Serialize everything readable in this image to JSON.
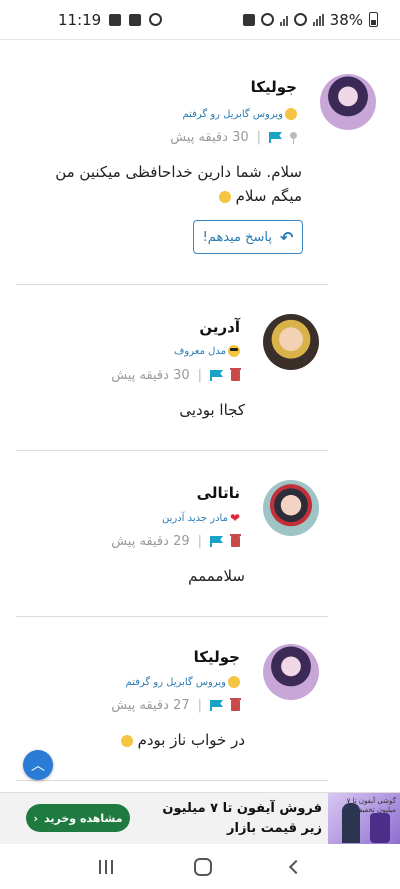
{
  "status_bar": {
    "time": "11:19",
    "battery": "38%"
  },
  "comments": [
    {
      "author": "جولیکا",
      "badge": "ویروس گابریل رو گرفتم",
      "badge_emoji": "smile",
      "time_ago": "30 دقیقه پیش",
      "body": "سلام. شما دارین خداحافظی میکنین من میگم سلام",
      "body_emoji": "smile",
      "reply_label": "پاسخ میدهم!"
    },
    {
      "author": "آدرین",
      "badge": "مدل معروف",
      "badge_emoji": "cool",
      "time_ago": "30 دقیقه پیش",
      "body": "کجاا بودیی"
    },
    {
      "author": "ناتالی",
      "badge": "مادر جدید آدرین",
      "badge_emoji": "heart",
      "time_ago": "29 دقیقه پیش",
      "body": "سلامممم"
    },
    {
      "author": "جولیکا",
      "badge": "ویروس گابریل رو گرفتم",
      "badge_emoji": "smile",
      "time_ago": "27 دقیقه پیش",
      "body": "در خواب ناز بودم",
      "body_emoji": "sleepy"
    }
  ],
  "ad": {
    "headline": "فروش آیفون تا ۷ میلیون زیر قیمت بازار",
    "cta": "مشاهده وخرید",
    "image_caption": "گوشی آیفون تا ۷ میلیون تخفیف"
  },
  "colors": {
    "accent": "#2a7bb5",
    "flag": "#17a2c6",
    "delete": "#c94a4a",
    "cta_green": "#1f7a3f"
  }
}
